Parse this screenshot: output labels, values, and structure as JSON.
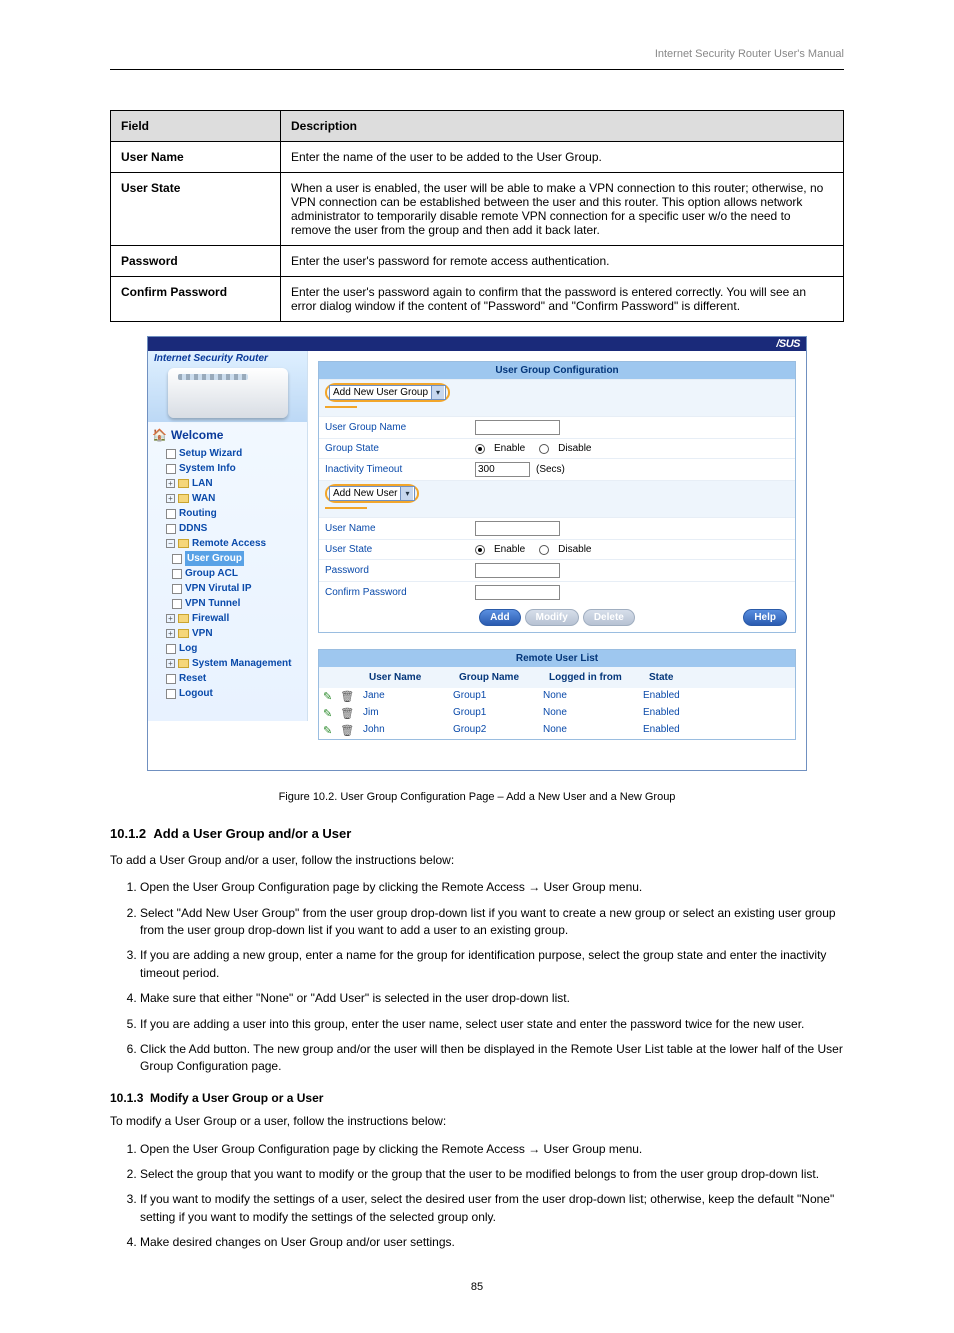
{
  "header": {
    "right": "Internet Security Router User's Manual"
  },
  "defs": {
    "head_field": "Field",
    "head_desc": "Description",
    "rows": [
      {
        "field": "User Name",
        "desc": "Enter the name of the user to be added to the User Group."
      },
      {
        "field": "User State",
        "desc": "When a user is enabled, the user will be able to make a VPN connection to this router; otherwise, no VPN connection can be established between the user and this router. This option allows network administrator to temporarily disable remote VPN connection for a specific user w/o the need to remove the user from the group and then add it back later."
      },
      {
        "field": "Password",
        "desc": "Enter the user's password for remote access authentication."
      },
      {
        "field": "Confirm Password",
        "desc": "Enter the user's password again to confirm that the password is entered correctly. You will see an error dialog window if the content of \"Password\" and \"Confirm Password\" is different."
      }
    ]
  },
  "figcap": {
    "no": "10.2",
    "text": "User Group Configuration Page – Add a New User and a New Group"
  },
  "ss": {
    "logo": "/SUS",
    "banner_title": "Internet Security Router",
    "nav": {
      "welcome": "Welcome",
      "setup": "Setup Wizard",
      "sysinfo": "System Info",
      "lan": "LAN",
      "wan": "WAN",
      "routing": "Routing",
      "ddns": "DDNS",
      "remote": "Remote Access",
      "usergroup": "User Group",
      "groupacl": "Group ACL",
      "vpnvip": "VPN Virutal IP",
      "vpntunnel": "VPN Tunnel",
      "firewall": "Firewall",
      "vpn": "VPN",
      "log": "Log",
      "sysmgmt": "System Management",
      "reset": "Reset",
      "logout": "Logout"
    },
    "panel": {
      "title": "User Group Configuration",
      "dd_group": "Add New User Group",
      "l_groupname": "User Group Name",
      "l_groupstate": "Group State",
      "enable": "Enable",
      "disable": "Disable",
      "l_timeout": "Inactivity Timeout",
      "timeout_val": "300",
      "secs": "(Secs)",
      "dd_user": "Add New User",
      "l_username": "User Name",
      "l_userstate": "User State",
      "l_password": "Password",
      "l_confirm": "Confirm Password",
      "btn_add": "Add",
      "btn_modify": "Modify",
      "btn_delete": "Delete",
      "btn_help": "Help"
    },
    "list": {
      "title": "Remote User List",
      "h_user": "User Name",
      "h_group": "Group Name",
      "h_from": "Logged in from",
      "h_state": "State",
      "rows": [
        {
          "u": "Jane",
          "g": "Group1",
          "f": "None",
          "s": "Enabled"
        },
        {
          "u": "Jim",
          "g": "Group1",
          "f": "None",
          "s": "Enabled"
        },
        {
          "u": "John",
          "g": "Group2",
          "f": "None",
          "s": "Enabled"
        }
      ]
    }
  },
  "body": {
    "sec_no": "10.1.2",
    "sec_title": "Add a User Group and/or a User",
    "intro": "To add a User Group and/or a user, follow the instructions below:",
    "steps_a": [
      "Open the User Group Configuration page by clicking the Remote Access → User Group menu.",
      "Select \"Add New User Group\" from the user group drop-down list if you want to create a new group or select an existing user group from the user group drop-down list if you want to add a user to an existing group.",
      "If you are adding a new group, enter a name for the group for identification purpose, select the group state and enter the inactivity timeout period.",
      "Make sure that either \"None\" or \"Add User\" is selected in the user drop-down list.",
      "If you are adding a user into this group, enter the user name, select user state and enter the password twice for the new user.",
      "Click the Add button. The new group and/or the user will then be displayed in the Remote User List table at the lower half of the User Group Configuration page."
    ],
    "sub_no": "10.1.3",
    "sub_title": "Modify a User Group or a User",
    "intro2": "To modify a User Group or a user, follow the instructions below:",
    "steps_b": [
      "Open the User Group Configuration page by clicking the Remote Access → User Group menu.",
      "Select the group that you want to modify or the group that the user to be modified belongs to from the user group drop-down list.",
      "If you want to modify the settings of a user, select the desired user from the user drop-down list; otherwise, keep the default \"None\" setting if you want to modify the settings of the selected group only.",
      "Make desired changes on User Group and/or user settings."
    ]
  },
  "pagenum": "85"
}
